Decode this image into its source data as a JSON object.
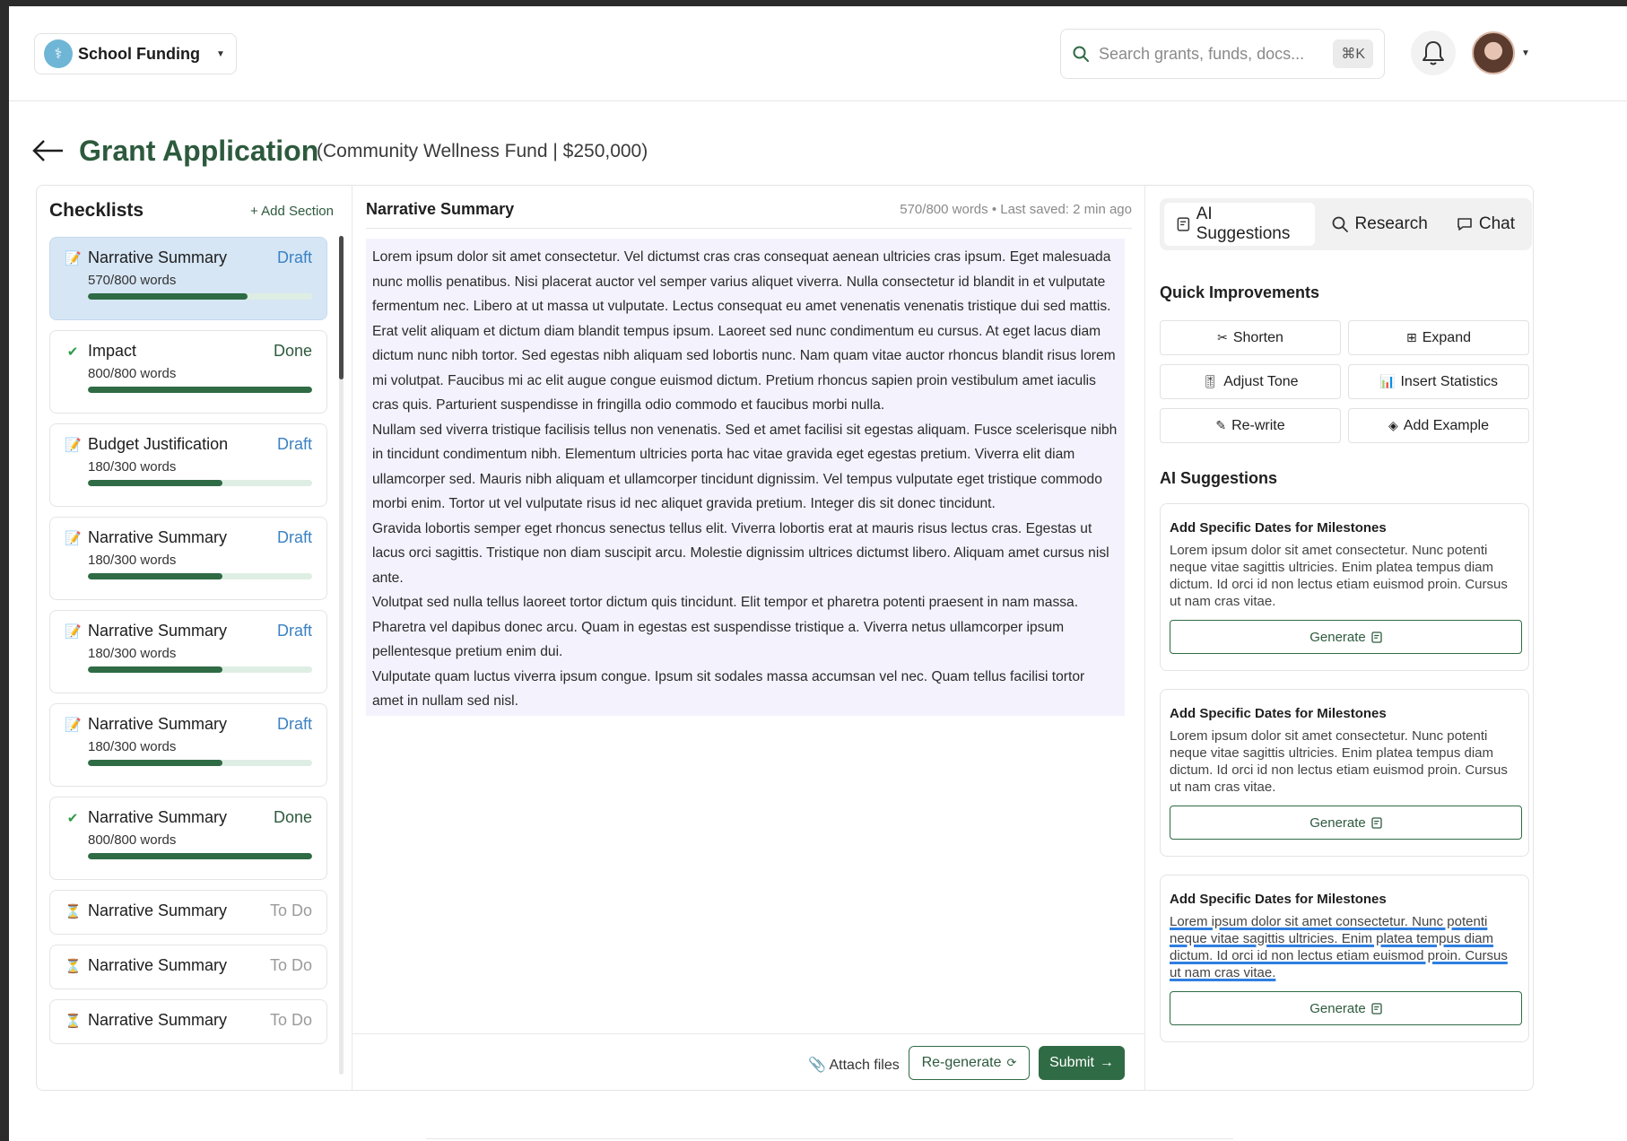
{
  "header": {
    "org_name": "School Funding",
    "search_placeholder": "Search grants, funds, docs...",
    "search_shortcut": "⌘K"
  },
  "page": {
    "title": "Grant Application",
    "subtitle": "(Community Wellness Fund | $250,000)"
  },
  "checklists": {
    "title": "Checklists",
    "add_label": "+ Add Section",
    "items": [
      {
        "title": "Narrative Summary",
        "status": "Draft",
        "words": "570/800 words",
        "progress": 0.7125
      },
      {
        "title": "Impact",
        "status": "Done",
        "words": "800/800 words",
        "progress": 1.0
      },
      {
        "title": "Budget Justification",
        "status": "Draft",
        "words": "180/300 words",
        "progress": 0.6
      },
      {
        "title": "Narrative Summary",
        "status": "Draft",
        "words": "180/300 words",
        "progress": 0.6
      },
      {
        "title": "Narrative Summary",
        "status": "Draft",
        "words": "180/300 words",
        "progress": 0.6
      },
      {
        "title": "Narrative Summary",
        "status": "Draft",
        "words": "180/300 words",
        "progress": 0.6
      },
      {
        "title": "Narrative Summary",
        "status": "Done",
        "words": "800/800 words",
        "progress": 1.0
      },
      {
        "title": "Narrative Summary",
        "status": "To Do"
      },
      {
        "title": "Narrative Summary",
        "status": "To Do"
      },
      {
        "title": "Narrative Summary",
        "status": "To Do"
      }
    ]
  },
  "editor": {
    "title": "Narrative Summary",
    "meta": "570/800 words • Last saved: 2 min ago",
    "paragraphs": [
      "Lorem ipsum dolor sit amet consectetur. Vel dictumst cras cras consequat aenean ultricies cras ipsum. Eget malesuada nunc mollis penatibus. Nisi placerat auctor vel semper varius aliquet viverra. Nulla consectetur id blandit in et vulputate fermentum nec. Libero at ut massa ut vulputate. Lectus consequat eu amet venenatis venenatis tristique dui sed mattis. Erat velit aliquam et dictum diam blandit tempus ipsum. Laoreet sed nunc condimentum eu cursus. At eget lacus diam dictum nunc nibh tortor. Sed egestas nibh aliquam sed lobortis nunc. Nam quam vitae auctor rhoncus blandit risus lorem mi volutpat. Faucibus mi ac elit augue congue euismod dictum. Pretium rhoncus sapien proin vestibulum amet iaculis cras quis. Parturient suspendisse in fringilla odio commodo et faucibus morbi nulla.",
      "Nullam sed viverra tristique facilisis tellus non venenatis. Sed et amet facilisi sit egestas aliquam. Fusce scelerisque nibh in tincidunt condimentum nibh. Elementum ultricies porta hac vitae gravida eget egestas pretium. Viverra elit diam ullamcorper sed. Mauris nibh aliquam et ullamcorper tincidunt dignissim. Vel tempus vulputate eget tristique commodo morbi enim. Tortor ut vel vulputate risus id nec aliquet gravida pretium. Integer dis sit donec tincidunt.",
      "Gravida lobortis semper eget rhoncus senectus tellus elit. Viverra lobortis erat at mauris risus lectus cras. Egestas ut lacus orci sagittis. Tristique non diam suscipit arcu. Molestie dignissim ultrices dictumst libero. Aliquam amet cursus nisl ante.",
      "Volutpat sed nulla tellus laoreet tortor dictum quis tincidunt. Elit tempor et pharetra potenti praesent in nam massa. Pharetra vel dapibus donec arcu. Quam in egestas est suspendisse tristique a. Viverra netus ullamcorper ipsum pellentesque pretium enim dui.",
      "Vulputate quam luctus viverra ipsum congue. Ipsum sit sodales massa accumsan vel nec. Quam tellus facilisi tortor amet in nullam sed nisl."
    ],
    "attach_label": "Attach files",
    "regenerate_label": "Re-generate",
    "submit_label": "Submit"
  },
  "sidebar": {
    "tabs": [
      {
        "label": "AI Suggestions",
        "icon": "ai-suggest-icon"
      },
      {
        "label": "Research",
        "icon": "search-icon"
      },
      {
        "label": "Chat",
        "icon": "chat-icon"
      }
    ],
    "quick_title": "Quick Improvements",
    "quick": [
      {
        "label": "Shorten",
        "icon": "✂"
      },
      {
        "label": "Expand",
        "icon": "⊞"
      },
      {
        "label": "Adjust Tone",
        "icon": "🎚"
      },
      {
        "label": "Insert Statistics",
        "icon": "📊"
      },
      {
        "label": "Re-write",
        "icon": "✎"
      },
      {
        "label": "Add Example",
        "icon": "◈"
      }
    ],
    "suggestions_title": "AI Suggestions",
    "cards": [
      {
        "title": "Add Specific Dates for Milestones",
        "text": "Lorem ipsum dolor sit amet consectetur. Nunc potenti neque vitae sagittis ultricies. Enim platea tempus diam dictum. Id orci id non lectus etiam euismod proin. Cursus ut nam cras vitae.",
        "button": "Generate"
      },
      {
        "title": "Add Specific Dates for Milestones",
        "text": "Lorem ipsum dolor sit amet consectetur. Nunc potenti neque vitae sagittis ultricies. Enim platea tempus diam dictum. Id orci id non lectus etiam euismod proin. Cursus ut nam cras vitae.",
        "button": "Generate"
      },
      {
        "title": "Add Specific Dates for Milestones",
        "text": "Lorem ipsum dolor sit amet consectetur. Nunc potenti neque vitae sagittis ultricies. Enim platea tempus diam dictum. Id orci id non lectus etiam euismod proin. Cursus ut nam cras vitae.",
        "button": "Generate"
      }
    ]
  },
  "colors": {
    "brand_green": "#2f6b45",
    "draft_blue": "#3b82c4",
    "active_item_bg": "#d6e6f5",
    "editor_bg": "#f4f2fd"
  }
}
